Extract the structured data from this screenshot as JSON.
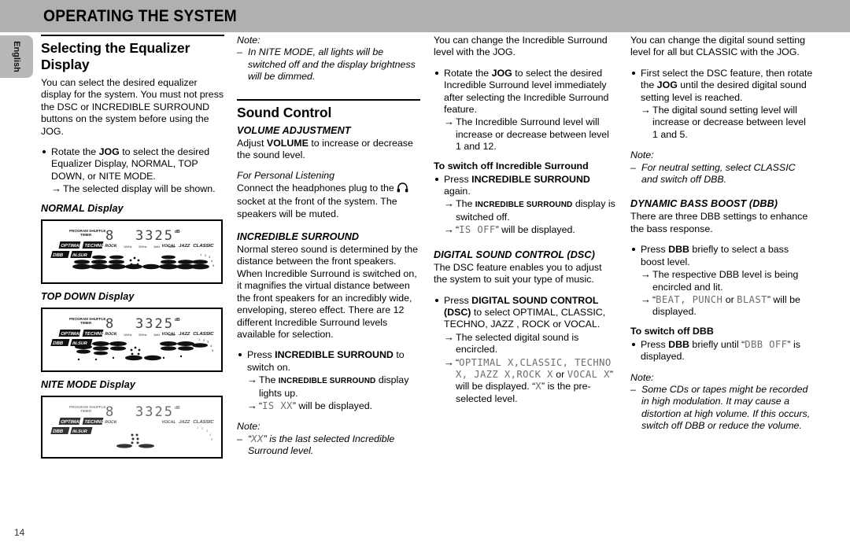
{
  "header": {
    "title": "OPERATING THE SYSTEM",
    "bar_color": "#b0b0b0"
  },
  "language_tab": {
    "label": "English"
  },
  "page_number": "14",
  "column_1": {
    "section_title": "Selecting the Equalizer Display",
    "intro": "You can select the desired equalizer display for the system. You must not press the DSC or INCREDIBLE SURROUND buttons on the system before using the JOG.",
    "bullet_1_pre": "Rotate the ",
    "bullet_1_bold": "JOG",
    "bullet_1_post": " to select the desired Equalizer Display, NORMAL, TOP DOWN, or NITE MODE.",
    "bullet_1_arrow": "The selected display will be shown.",
    "fig_1_caption": "NORMAL Display",
    "fig_2_caption": "TOP DOWN Display",
    "fig_3_caption": "NITE MODE Display",
    "lcd": {
      "program_label": "PROGRAM SHUFFLE",
      "timer_label": "TIMER",
      "digit_single": "8",
      "digits_main": "3325",
      "db_label": "dB",
      "presets_left": [
        "OPTIMAL",
        "TECHNO",
        "ROCK"
      ],
      "presets_right": [
        "VOCAL",
        "JAZZ",
        "CLASSIC"
      ],
      "dbb_label": "DBB",
      "surround_label": "IN. SUR",
      "freq_labels": [
        "100Hz",
        "300Hz",
        "1kHz",
        "3kHz",
        "10kHz"
      ],
      "level_digits": [
        "1",
        "2",
        "3",
        "4",
        "5"
      ]
    }
  },
  "column_2": {
    "note_label": "Note:",
    "note_text": "In NITE MODE, all lights will be switched off and the display brightness will be dimmed.",
    "section_title": "Sound Control",
    "sub_1": "VOLUME ADJUSTMENT",
    "sub_1_pre": "Adjust ",
    "sub_1_bold": "VOLUME",
    "sub_1_post": " to increase or decrease the sound level.",
    "personal_heading": "For Personal Listening",
    "personal_pre": "Connect the headphones plug to the ",
    "personal_icon": "headphones-icon",
    "personal_post": " socket at the front of the system. The speakers will be muted.",
    "sub_2": "INCREDIBLE SURROUND",
    "sub_2_body": "Normal stereo sound is determined by the distance between the front speakers. When Incredible Surround is switched on, it magnifies the virtual distance between the front speakers for an incredibly wide, enveloping, stereo effect. There are 12 different Incredible Surround levels available for selection.",
    "bullet_pre": "Press ",
    "bullet_bold": "INCREDIBLE SURROUND",
    "bullet_post": " to switch on.",
    "arrow_1_pre": "The ",
    "arrow_1_caps": "INCREDIBLE SURROUND",
    "arrow_1_post": " display lights up.",
    "arrow_2_pre": "“",
    "arrow_2_lcd": "IS XX",
    "arrow_2_post": "” will be displayed.",
    "note2_label": "Note:",
    "note2_pre": "“",
    "note2_lcd": "XX",
    "note2_post": "” is the last selected Incredible Surround level."
  },
  "column_3": {
    "intro": "You can change the Incredible Surround level with the JOG.",
    "bullet_1_pre": "Rotate the ",
    "bullet_1_bold": "JOG",
    "bullet_1_post": " to select the desired Incredible Surround level immediately after selecting the Incredible Surround feature.",
    "bullet_1_arrow": "The Incredible Surround level will increase or decrease between level 1 and 12.",
    "switch_off_heading": "To switch off Incredible Surround",
    "switch_off_pre": "Press ",
    "switch_off_bold": "INCREDIBLE SURROUND",
    "switch_off_post": " again.",
    "arrow_1_pre": "The ",
    "arrow_1_caps": "INCREDIBLE SURROUND",
    "arrow_1_post": " display is switched off.",
    "arrow_2_pre": "“",
    "arrow_2_lcd": "IS OFF",
    "arrow_2_post": "” will be displayed.",
    "sub_1": "DIGITAL SOUND CONTROL  (DSC)",
    "sub_1_body": "The DSC feature enables you to adjust the system to suit your type of music.",
    "bullet_2_pre": "Press ",
    "bullet_2_bold": "DIGITAL SOUND CONTROL (DSC)",
    "bullet_2_post": " to select OPTIMAL, CLASSIC, TECHNO, JAZZ , ROCK or VOCAL.",
    "arrow_3": "The selected digital sound is encircled.",
    "arrow_4_pre": "“",
    "arrow_4_lcd": "OPTIMAL X,CLASSIC, TECHNO X, JAZZ X,ROCK X",
    "arrow_4_mid": " or ",
    "arrow_4_lcd2": "VOCAL  X",
    "arrow_4_post": "” will be displayed.",
    "arrow_4_tail_pre": "“",
    "arrow_4_tail_lcd": "X",
    "arrow_4_tail_post": "” is the pre-selected level."
  },
  "column_4": {
    "intro": "You can change the digital sound setting level for all but CLASSIC with the JOG.",
    "bullet_1_pre": "First select the DSC feature, then rotate the ",
    "bullet_1_bold": "JOG",
    "bullet_1_post": " until the desired digital sound setting level is reached.",
    "bullet_1_arrow": "The digital sound setting level will increase or decrease between level 1 and 5.",
    "note_label": "Note:",
    "note_text": "For neutral setting, select CLASSIC and switch off DBB.",
    "sub_1": "DYNAMIC BASS BOOST  (DBB)",
    "sub_1_body": "There are three DBB settings to enhance the bass response.",
    "bullet_2_pre": "Press ",
    "bullet_2_bold": "DBB",
    "bullet_2_post": " briefly to select a bass boost level.",
    "arrow_1": "The respective DBB level is being encircled and lit.",
    "arrow_2_pre": "“",
    "arrow_2_lcd": "BEAT, PUNCH",
    "arrow_2_mid": " or ",
    "arrow_2_lcd2": "BLAST",
    "arrow_2_post": "” will be displayed.",
    "switch_off_heading": "To switch off DBB",
    "switch_off_pre": "Press ",
    "switch_off_bold": "DBB",
    "switch_off_mid": " briefly until “",
    "switch_off_lcd": "DBB OFF",
    "switch_off_post": "” is displayed.",
    "note2_label": "Note:",
    "note2_text": "Some CDs or tapes might be recorded in high modulation. It may cause a distortion at high volume. If this occurs, switch off DBB or reduce the volume."
  }
}
